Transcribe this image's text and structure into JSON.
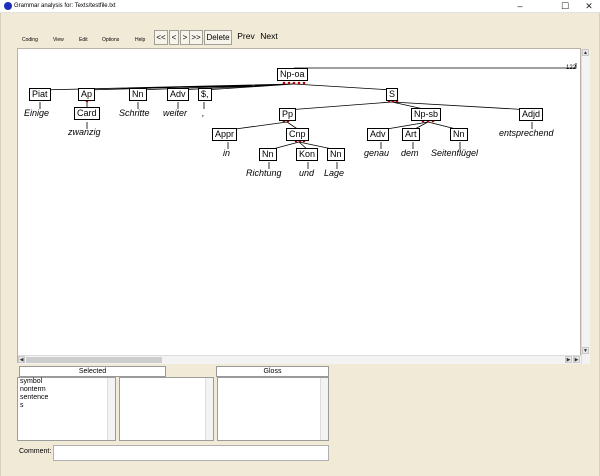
{
  "window": {
    "title": "Grammar analysis for: Texts/testfile.txt",
    "minimize": "–",
    "maximize": "☐",
    "close": "✕"
  },
  "menu": [
    "Coding",
    "View",
    "Edit",
    "Options",
    "Help"
  ],
  "nav": {
    "first": "<<",
    "prev_one": "<",
    "next_one": ">",
    "last": ">>",
    "delete": "Delete",
    "prev": "Prev",
    "next": "Next"
  },
  "tree": {
    "nodes": {
      "np_oa": "Np-oa",
      "piat": "Piat",
      "ap": "Ap",
      "card": "Card",
      "nn1": "Nn",
      "adv1": "Adv",
      "punct": "$,",
      "s": "S",
      "pp": "Pp",
      "np_sb": "Np-sb",
      "adjd": "Adjd",
      "appr": "Appr",
      "cnp": "Cnp",
      "adv2": "Adv",
      "art": "Art",
      "nn2": "Nn",
      "nn3": "Nn",
      "kon": "Kon",
      "nn4": "Nn"
    },
    "words": {
      "einige": "Einige",
      "zwanzig": "zwanzig",
      "schritte": "Schritte",
      "weiter": "weiter",
      "comma": ",",
      "in": "in",
      "richtung": "Richtung",
      "und": "und",
      "lage": "Lage",
      "genau": "genau",
      "dem": "dem",
      "seitenfluegel": "Seitenflügel",
      "entsprechend": "entsprechend"
    },
    "edge_label": "122"
  },
  "panels": {
    "selected_header": "Selected",
    "gloss_header": "Gloss",
    "selected_items": [
      "symbol",
      "nonterm",
      "sentence",
      "s"
    ]
  },
  "comment": {
    "label": "Comment:",
    "value": ""
  },
  "colors": {
    "frame": "#f1ead7",
    "tree_line": "#000000",
    "head_marker": "#b00000"
  }
}
